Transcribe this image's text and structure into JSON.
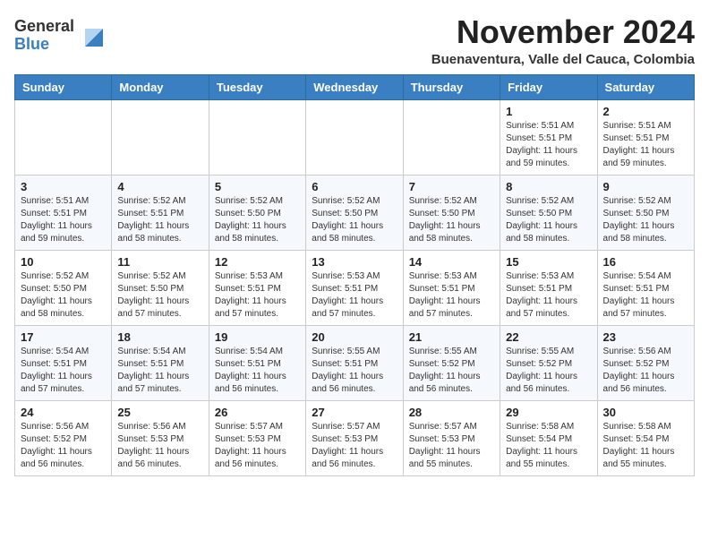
{
  "header": {
    "logo_general": "General",
    "logo_blue": "Blue",
    "month_title": "November 2024",
    "location": "Buenaventura, Valle del Cauca, Colombia"
  },
  "calendar": {
    "days_of_week": [
      "Sunday",
      "Monday",
      "Tuesday",
      "Wednesday",
      "Thursday",
      "Friday",
      "Saturday"
    ],
    "weeks": [
      [
        {
          "day": "",
          "info": ""
        },
        {
          "day": "",
          "info": ""
        },
        {
          "day": "",
          "info": ""
        },
        {
          "day": "",
          "info": ""
        },
        {
          "day": "",
          "info": ""
        },
        {
          "day": "1",
          "info": "Sunrise: 5:51 AM\nSunset: 5:51 PM\nDaylight: 11 hours and 59 minutes."
        },
        {
          "day": "2",
          "info": "Sunrise: 5:51 AM\nSunset: 5:51 PM\nDaylight: 11 hours and 59 minutes."
        }
      ],
      [
        {
          "day": "3",
          "info": "Sunrise: 5:51 AM\nSunset: 5:51 PM\nDaylight: 11 hours and 59 minutes."
        },
        {
          "day": "4",
          "info": "Sunrise: 5:52 AM\nSunset: 5:51 PM\nDaylight: 11 hours and 58 minutes."
        },
        {
          "day": "5",
          "info": "Sunrise: 5:52 AM\nSunset: 5:50 PM\nDaylight: 11 hours and 58 minutes."
        },
        {
          "day": "6",
          "info": "Sunrise: 5:52 AM\nSunset: 5:50 PM\nDaylight: 11 hours and 58 minutes."
        },
        {
          "day": "7",
          "info": "Sunrise: 5:52 AM\nSunset: 5:50 PM\nDaylight: 11 hours and 58 minutes."
        },
        {
          "day": "8",
          "info": "Sunrise: 5:52 AM\nSunset: 5:50 PM\nDaylight: 11 hours and 58 minutes."
        },
        {
          "day": "9",
          "info": "Sunrise: 5:52 AM\nSunset: 5:50 PM\nDaylight: 11 hours and 58 minutes."
        }
      ],
      [
        {
          "day": "10",
          "info": "Sunrise: 5:52 AM\nSunset: 5:50 PM\nDaylight: 11 hours and 58 minutes."
        },
        {
          "day": "11",
          "info": "Sunrise: 5:52 AM\nSunset: 5:50 PM\nDaylight: 11 hours and 57 minutes."
        },
        {
          "day": "12",
          "info": "Sunrise: 5:53 AM\nSunset: 5:51 PM\nDaylight: 11 hours and 57 minutes."
        },
        {
          "day": "13",
          "info": "Sunrise: 5:53 AM\nSunset: 5:51 PM\nDaylight: 11 hours and 57 minutes."
        },
        {
          "day": "14",
          "info": "Sunrise: 5:53 AM\nSunset: 5:51 PM\nDaylight: 11 hours and 57 minutes."
        },
        {
          "day": "15",
          "info": "Sunrise: 5:53 AM\nSunset: 5:51 PM\nDaylight: 11 hours and 57 minutes."
        },
        {
          "day": "16",
          "info": "Sunrise: 5:54 AM\nSunset: 5:51 PM\nDaylight: 11 hours and 57 minutes."
        }
      ],
      [
        {
          "day": "17",
          "info": "Sunrise: 5:54 AM\nSunset: 5:51 PM\nDaylight: 11 hours and 57 minutes."
        },
        {
          "day": "18",
          "info": "Sunrise: 5:54 AM\nSunset: 5:51 PM\nDaylight: 11 hours and 57 minutes."
        },
        {
          "day": "19",
          "info": "Sunrise: 5:54 AM\nSunset: 5:51 PM\nDaylight: 11 hours and 56 minutes."
        },
        {
          "day": "20",
          "info": "Sunrise: 5:55 AM\nSunset: 5:51 PM\nDaylight: 11 hours and 56 minutes."
        },
        {
          "day": "21",
          "info": "Sunrise: 5:55 AM\nSunset: 5:52 PM\nDaylight: 11 hours and 56 minutes."
        },
        {
          "day": "22",
          "info": "Sunrise: 5:55 AM\nSunset: 5:52 PM\nDaylight: 11 hours and 56 minutes."
        },
        {
          "day": "23",
          "info": "Sunrise: 5:56 AM\nSunset: 5:52 PM\nDaylight: 11 hours and 56 minutes."
        }
      ],
      [
        {
          "day": "24",
          "info": "Sunrise: 5:56 AM\nSunset: 5:52 PM\nDaylight: 11 hours and 56 minutes."
        },
        {
          "day": "25",
          "info": "Sunrise: 5:56 AM\nSunset: 5:53 PM\nDaylight: 11 hours and 56 minutes."
        },
        {
          "day": "26",
          "info": "Sunrise: 5:57 AM\nSunset: 5:53 PM\nDaylight: 11 hours and 56 minutes."
        },
        {
          "day": "27",
          "info": "Sunrise: 5:57 AM\nSunset: 5:53 PM\nDaylight: 11 hours and 56 minutes."
        },
        {
          "day": "28",
          "info": "Sunrise: 5:57 AM\nSunset: 5:53 PM\nDaylight: 11 hours and 55 minutes."
        },
        {
          "day": "29",
          "info": "Sunrise: 5:58 AM\nSunset: 5:54 PM\nDaylight: 11 hours and 55 minutes."
        },
        {
          "day": "30",
          "info": "Sunrise: 5:58 AM\nSunset: 5:54 PM\nDaylight: 11 hours and 55 minutes."
        }
      ]
    ]
  }
}
